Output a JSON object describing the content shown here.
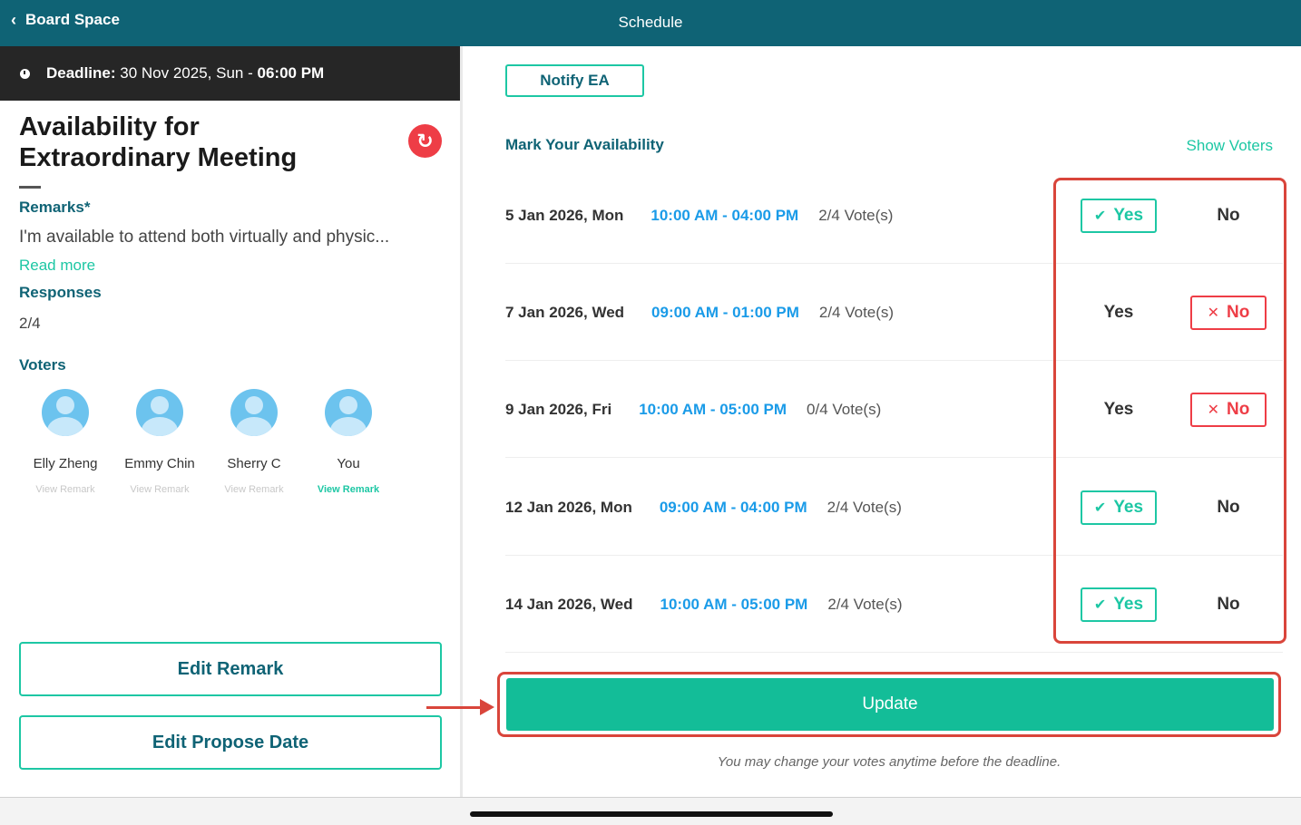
{
  "header": {
    "back_label": "Board Space",
    "title": "Schedule"
  },
  "deadline": {
    "label": "Deadline:",
    "date": "30 Nov 2025, Sun",
    "separator": "-",
    "time": "06:00 PM"
  },
  "meeting": {
    "title_line1": "Availability for",
    "title_line2": "Extraordinary Meeting",
    "remarks_label": "Remarks*",
    "remarks_text": "I'm available to attend both virtually and physic...",
    "read_more": "Read more",
    "responses_label": "Responses",
    "responses_value": "2/4",
    "voters_label": "Voters",
    "voters": [
      {
        "name": "Elly Zheng",
        "remark_link": "View Remark"
      },
      {
        "name": "Emmy Chin",
        "remark_link": "View Remark"
      },
      {
        "name": "Sherry C",
        "remark_link": "View Remark"
      },
      {
        "name": "You",
        "remark_link": "View Remark"
      }
    ],
    "edit_remark": "Edit Remark",
    "edit_propose_date": "Edit Propose Date"
  },
  "schedule": {
    "notify_label": "Notify EA",
    "mark_label": "Mark Your Availability",
    "show_voters": "Show Voters",
    "yes_label": "Yes",
    "no_label": "No",
    "rows": [
      {
        "date": "5 Jan 2026, Mon",
        "time": "10:00 AM - 04:00 PM",
        "votes": "2/4 Vote(s)",
        "selected": "yes"
      },
      {
        "date": "7 Jan 2026, Wed",
        "time": "09:00 AM - 01:00 PM",
        "votes": "2/4 Vote(s)",
        "selected": "no"
      },
      {
        "date": "9 Jan 2026, Fri",
        "time": "10:00 AM - 05:00 PM",
        "votes": "0/4 Vote(s)",
        "selected": "no"
      },
      {
        "date": "12 Jan 2026, Mon",
        "time": "09:00 AM - 04:00 PM",
        "votes": "2/4 Vote(s)",
        "selected": "yes"
      },
      {
        "date": "14 Jan 2026, Wed",
        "time": "10:00 AM - 05:00 PM",
        "votes": "2/4 Vote(s)",
        "selected": "yes"
      }
    ],
    "update_label": "Update",
    "footnote": "You may change your votes anytime before the deadline."
  },
  "colors": {
    "header": "#0f6375",
    "accent": "#1dc7a4",
    "update": "#13bd98",
    "time": "#1a9be8",
    "no_red": "#ee3d46",
    "highlight": "#d9453b"
  },
  "icons": {
    "back": "chevron-left-icon",
    "refresh": "refresh-icon",
    "clock": "clock-icon",
    "check": "check-icon",
    "cross": "x-icon",
    "avatar": "user-avatar-icon"
  }
}
